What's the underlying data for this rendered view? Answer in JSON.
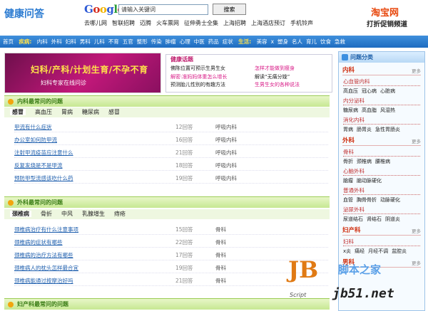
{
  "header": {
    "logo": "健康问答",
    "google_letters": [
      "G",
      "o",
      "o",
      "g",
      "l",
      "e"
    ],
    "search_placeholder": "请输入关键词",
    "search_button": "搜索",
    "hot_links": [
      "去哪儿网",
      "智联招聘",
      "迈腾",
      "火车票网",
      "征伸勇士全集",
      "上海招聘",
      "上海酒店预订",
      "手机铃声"
    ],
    "taobao_logo": "淘宝网",
    "taobao_slogan": "打折促销频道"
  },
  "navbar": {
    "home": "首页",
    "disease_label": "疾病:",
    "diseases": [
      "内科",
      "外科",
      "妇科",
      "男科",
      "儿科",
      "不育",
      "五官",
      "整形",
      "传染",
      "肿瘤",
      "心理",
      "中医",
      "药品",
      "症状"
    ],
    "life_label": "生活:",
    "life": [
      "美容",
      "x",
      "塑身",
      "名人",
      "育儿",
      "饮食",
      "急救"
    ]
  },
  "banner": {
    "title": "妇科/产科/计划生育/不孕不育",
    "subtitle": "妇科专家在线问诊"
  },
  "ad": {
    "title": "健康话题",
    "left": [
      "佛陈位置可预示生男生女",
      "解密:准妈妈体重怎么增长",
      "预测胎儿性别的有趣方法"
    ],
    "right": [
      "怎样才能做到瘦身",
      "解读“无痛分娩”",
      "生男生女的各种说法"
    ]
  },
  "sections": [
    {
      "title": "内科最常问的问题",
      "tabs": [
        "感冒",
        "高血压",
        "胃病",
        "糖尿病",
        "感冒"
      ],
      "rows": [
        {
          "q": "甲流有什么症状",
          "n": "12回答",
          "d": "呼吸内科"
        },
        {
          "q": "办公室如何防甲流",
          "n": "16回答",
          "d": "呼吸内科"
        },
        {
          "q": "注射甲流疫苗应注意什么",
          "n": "21回答",
          "d": "呼吸内科"
        },
        {
          "q": "反复发烧是不是甲流",
          "n": "18回答",
          "d": "呼吸内科"
        },
        {
          "q": "预防甲型流感该吃什么药",
          "n": "19回答",
          "d": "呼吸内科"
        }
      ]
    },
    {
      "title": "外科最常问的问题",
      "tabs": [
        "颈椎病",
        "骨折",
        "中风",
        "乳腺增生",
        "痔疮"
      ],
      "rows": [
        {
          "q": "颈椎病治疗有什么注意事项",
          "n": "15回答",
          "d": "骨科"
        },
        {
          "q": "颈椎病的症状有哪些",
          "n": "22回答",
          "d": "骨科"
        },
        {
          "q": "颈椎病的治疗方法有哪些",
          "n": "17回答",
          "d": "骨科"
        },
        {
          "q": "颈椎病人的枕头怎样最合宜",
          "n": "19回答",
          "d": "骨科"
        },
        {
          "q": "颈椎病能通过按摩治好吗",
          "n": "21回答",
          "d": "骨科"
        }
      ]
    },
    {
      "title": "妇产科最常问的问题"
    }
  ],
  "sidebar": {
    "title": "问题分类",
    "more": "更多",
    "categories": [
      {
        "name": "内科",
        "groups": [
          {
            "name": "心血管内科",
            "items": [
              "高血压",
              "冠心病",
              "心脏病"
            ]
          },
          {
            "name": "内分泌科",
            "items": [
              "糖尿病",
              "高血脂",
              "风湿热"
            ]
          },
          {
            "name": "消化内科",
            "items": [
              "胃病",
              "肠胃炎",
              "急性胃肠炎"
            ]
          }
        ]
      },
      {
        "name": "外科",
        "groups": [
          {
            "name": "骨科",
            "items": [
              "骨折",
              "颈椎病",
              "腰椎病"
            ]
          },
          {
            "name": "心脑外科",
            "items": [
              "脑瘤",
              "脑动脉硬化"
            ]
          },
          {
            "name": "普通外科",
            "items": [
              "血管",
              "胸骨骨折",
              "动脉硬化"
            ]
          },
          {
            "name": "泌尿外科",
            "items": [
              "尿道结石",
              "肾结石",
              "阴道炎"
            ]
          }
        ]
      },
      {
        "name": "妇产科",
        "groups": [
          {
            "name": "妇科",
            "items": [
              "x炎",
              "痛经",
              "月经不调",
              "盆腔炎"
            ]
          }
        ]
      },
      {
        "name": "男科",
        "groups": []
      }
    ]
  },
  "watermark": {
    "logo": "JB",
    "script": "Script",
    "cn": "脚本之家",
    "url": "jb51.net"
  }
}
